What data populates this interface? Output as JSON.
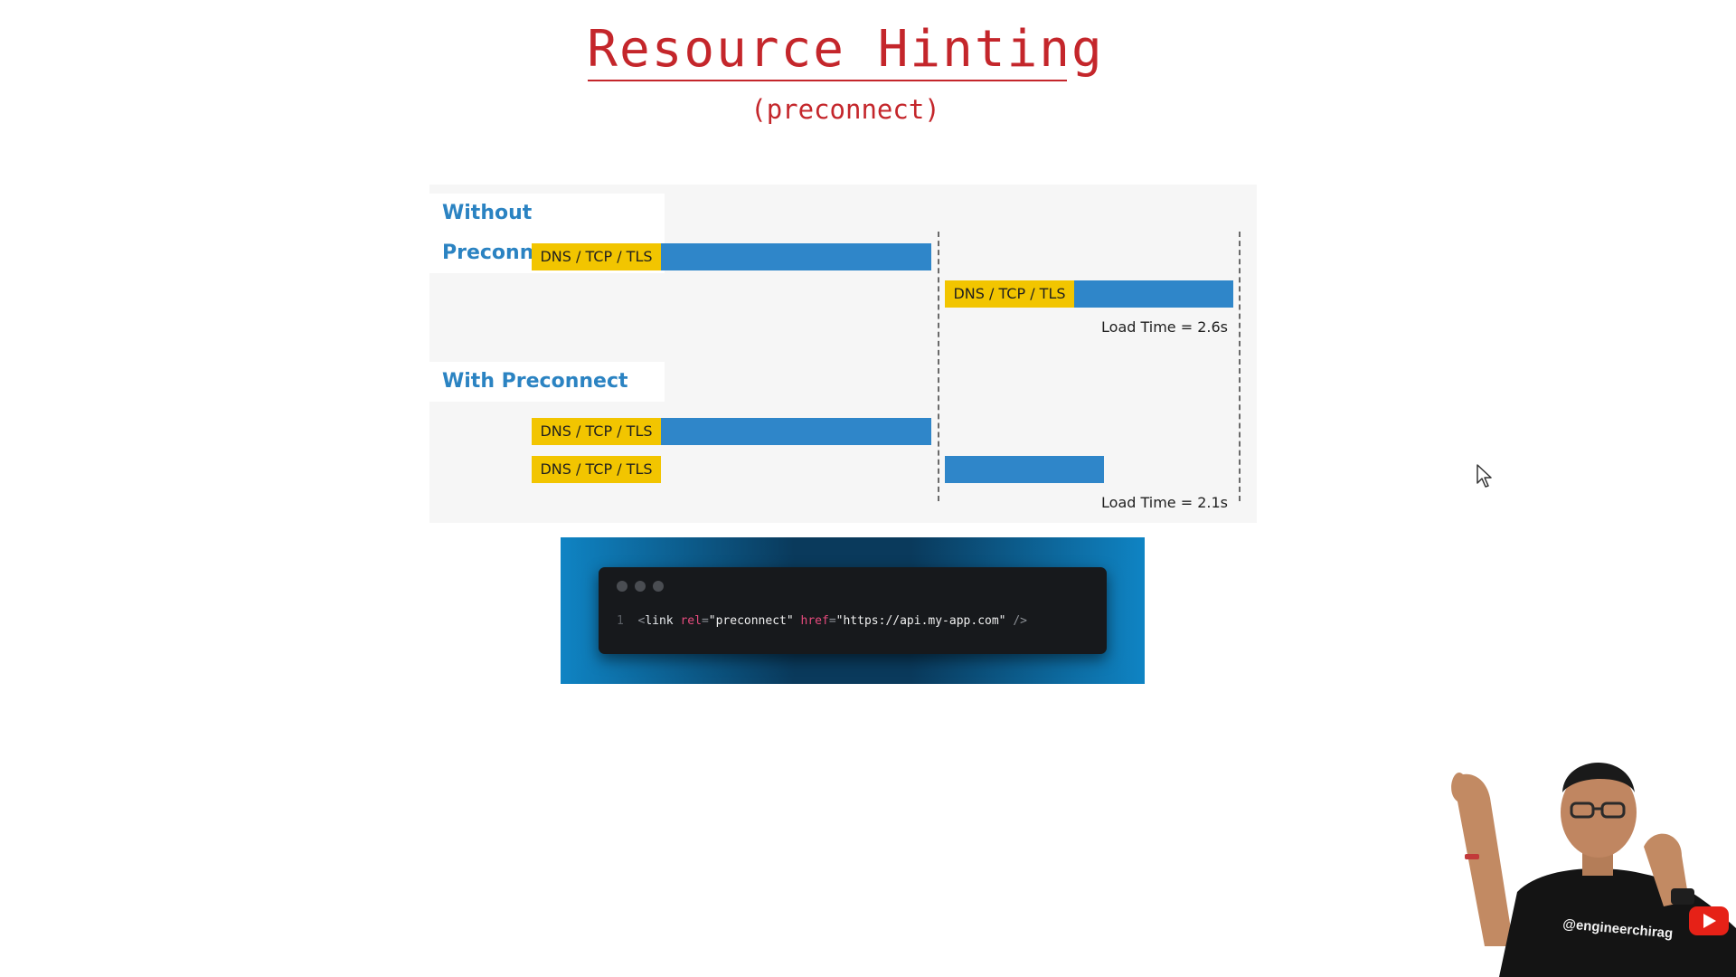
{
  "slide": {
    "title": "Resource Hinting",
    "subtitle": "(preconnect)"
  },
  "diagram": {
    "without": {
      "label": "Without Preconnect",
      "bar1_label": "DNS / TCP / TLS",
      "bar2_label": "DNS / TCP / TLS",
      "load_time": "Load Time = 2.6s"
    },
    "with": {
      "label": "With Preconnect",
      "bar1_label": "DNS / TCP / TLS",
      "bar2_label": "DNS / TCP / TLS",
      "load_time": "Load Time = 2.1s"
    },
    "colors": {
      "connection": "#f2c500",
      "download": "#2f86c9"
    }
  },
  "code": {
    "line_number": "1",
    "open": "<",
    "tag": "link",
    "attr1": "rel",
    "eq1": "=",
    "val1": "\"preconnect\"",
    "attr2": "href",
    "eq2": "=",
    "val2": "\"https://api.my-app.com\"",
    "close": "/>"
  },
  "presenter": {
    "shirt_text": "@engineerchirag"
  },
  "icons": [
    "cursor-icon",
    "youtube-subscribe-icon"
  ],
  "colors": {
    "title": "#c4262b",
    "section_label": "#2b83c2"
  }
}
